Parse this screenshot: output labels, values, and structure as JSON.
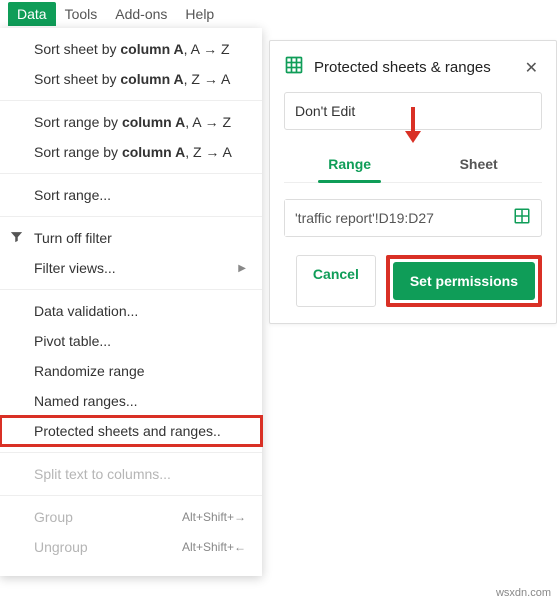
{
  "menubar": {
    "items": [
      "Data",
      "Tools",
      "Add-ons",
      "Help"
    ],
    "active_index": 0
  },
  "dropdown": {
    "sort_sheet_az_prefix": "Sort sheet by ",
    "sort_sheet_az_col": "column A",
    "sort_sheet_az_suffix": ", A → Z",
    "sort_sheet_za_prefix": "Sort sheet by ",
    "sort_sheet_za_col": "column A",
    "sort_sheet_za_suffix": ", Z → A",
    "sort_range_az_prefix": "Sort range by ",
    "sort_range_az_col": "column A",
    "sort_range_az_suffix": ", A → Z",
    "sort_range_za_prefix": "Sort range by ",
    "sort_range_za_col": "column A",
    "sort_range_za_suffix": ", Z → A",
    "sort_range": "Sort range...",
    "turn_off_filter": "Turn off filter",
    "filter_views": "Filter views...",
    "data_validation": "Data validation...",
    "pivot_table": "Pivot table...",
    "randomize_range": "Randomize range",
    "named_ranges": "Named ranges...",
    "protected_sheets": "Protected sheets and ranges..",
    "split_text": "Split text to columns...",
    "group": "Group",
    "group_shortcut": "Alt+Shift+→",
    "ungroup": "Ungroup",
    "ungroup_shortcut": "Alt+Shift+←"
  },
  "panel": {
    "title": "Protected sheets & ranges",
    "description_value": "Don't Edit",
    "tab_range": "Range",
    "tab_sheet": "Sheet",
    "range_value": "'traffic report'!D19:D27",
    "cancel": "Cancel",
    "set_permissions": "Set permissions"
  },
  "watermark": "wsxdn.com"
}
